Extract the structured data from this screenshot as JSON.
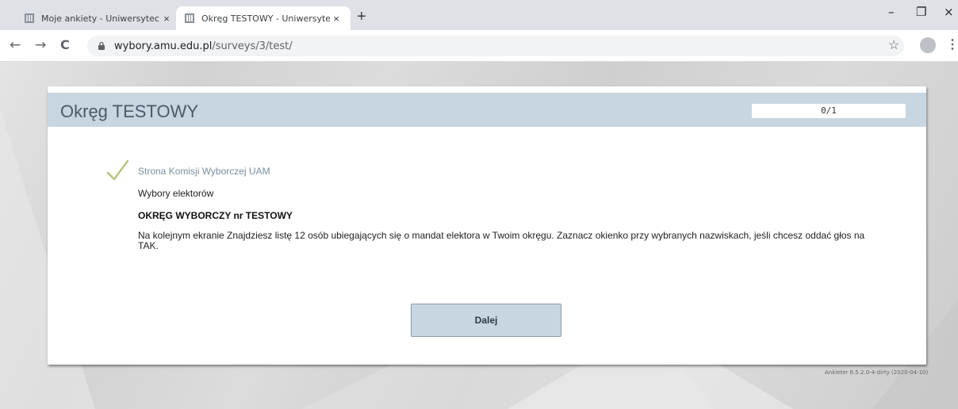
{
  "browser": {
    "tabs": [
      {
        "title": "Moje ankiety - Uniwersytecki Sys",
        "close": "×"
      },
      {
        "title": "Okręg TESTOWY - Uniwersytecki",
        "close": "×"
      }
    ],
    "new_tab": "+",
    "window_controls": {
      "minimize": "–",
      "restore": "❐",
      "close": "×"
    },
    "nav": {
      "back": "←",
      "forward": "→",
      "reload": "C"
    },
    "url_domain": "wybory.amu.edu.pl",
    "url_path": "/surveys/3/test/",
    "bookmark": "☆",
    "menu": "⋮"
  },
  "survey": {
    "title": "Okręg TESTOWY",
    "progress": "0/1",
    "commission_link": "Strona Komisji Wyborczej UAM",
    "election_name": "Wybory elektorów",
    "district": "OKRĘG WYBORCZY nr TESTOWY",
    "instructions": "Na kolejnym ekranie Znajdziesz listę 12 osób ubiegających się o mandat elektora w Twoim okręgu. Zaznacz okienko przy wybranych nazwiskach, jeśli chcesz oddać głos na TAK.",
    "next_label": "Dalej"
  },
  "footer": {
    "version": "Ankieter 6.5.2.0-4-dirty (2020-04-10)"
  },
  "colors": {
    "header_band": "#c8d6e1",
    "link": "#7b8ea0",
    "checkmark": "#b8c27a"
  },
  "icons": [
    "favicon-icon",
    "lock-icon",
    "checkmark-icon",
    "star-icon",
    "avatar-icon"
  ]
}
